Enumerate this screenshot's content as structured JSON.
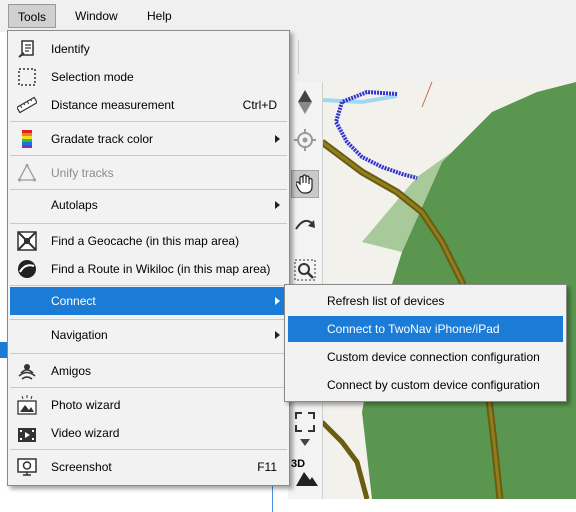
{
  "menubar": {
    "items": [
      "Tools",
      "Window",
      "Help"
    ]
  },
  "tools_menu": {
    "items": [
      {
        "label": "Identify",
        "icon": "identify-icon"
      },
      {
        "label": "Selection mode",
        "icon": "selection-icon"
      },
      {
        "label": "Distance measurement",
        "icon": "ruler-icon",
        "shortcut": "Ctrl+D"
      },
      {
        "label": "Gradate track color",
        "icon": "gradient-icon",
        "submenu": true
      },
      {
        "label": "Unify tracks",
        "icon": "unify-icon",
        "disabled": true
      },
      {
        "label": "Autolaps",
        "submenu": true
      },
      {
        "label": "Find a Geocache (in this map area)",
        "icon": "geocache-icon"
      },
      {
        "label": "Find a Route in Wikiloc (in this map area)",
        "icon": "wikiloc-icon"
      },
      {
        "label": "Connect",
        "submenu": true,
        "highlighted": true
      },
      {
        "label": "Navigation",
        "submenu": true
      },
      {
        "label": "Amigos",
        "icon": "amigos-icon"
      },
      {
        "label": "Photo wizard",
        "icon": "photo-icon"
      },
      {
        "label": "Video wizard",
        "icon": "video-icon"
      },
      {
        "label": "Screenshot",
        "icon": "screenshot-icon",
        "shortcut": "F11"
      }
    ]
  },
  "connect_submenu": {
    "items": [
      {
        "label": "Refresh list of devices"
      },
      {
        "label": "Connect to TwoNav iPhone/iPad",
        "highlighted": true
      },
      {
        "label": "Custom device connection configuration"
      },
      {
        "label": "Connect by custom device configuration"
      }
    ]
  },
  "side_toolbar": {
    "threed_label": "3D"
  },
  "colors": {
    "accent": "#1a7cd7",
    "map_green": "#5b9650",
    "track": "#3333cc",
    "road": "#6b5c10"
  }
}
